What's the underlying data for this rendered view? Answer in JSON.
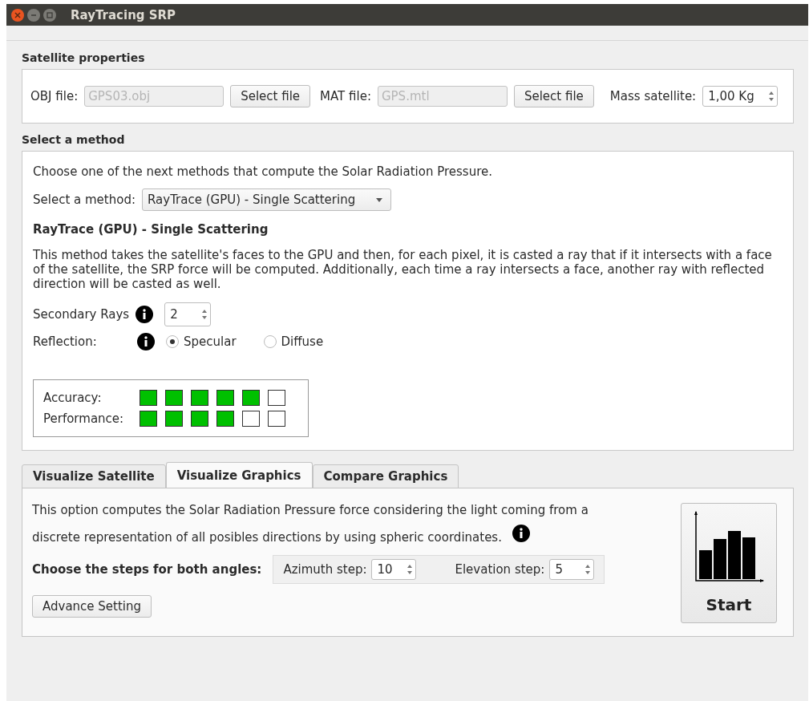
{
  "window": {
    "title": "RayTracing SRP"
  },
  "satellite_properties": {
    "title": "Satellite properties",
    "obj_label": "OBJ file:",
    "obj_value": "GPS03.obj",
    "obj_button": "Select file",
    "mat_label": "MAT file:",
    "mat_value": "GPS.mtl",
    "mat_button": "Select file",
    "mass_label": "Mass satellite:",
    "mass_value": "1,00 Kg"
  },
  "method": {
    "title": "Select a method",
    "intro": "Choose one of the next methods that compute the Solar Radiation Pressure.",
    "select_label": "Select a method:",
    "select_value": "RayTrace (GPU) - Single Scattering",
    "heading": "RayTrace (GPU) - Single Scattering",
    "description": "This method takes the satellite's faces to the GPU and then, for each pixel, it is casted a ray that if it intersects with a face of the satellite, the SRP force will be computed. Additionally, each time a ray intersects a face, another ray with reflected direction will be casted as well.",
    "secondary_label": "Secondary Rays",
    "secondary_value": "2",
    "reflection_label": "Reflection:",
    "reflection_options": [
      {
        "label": "Specular",
        "selected": true
      },
      {
        "label": "Diffuse",
        "selected": false
      }
    ],
    "ratings": [
      {
        "label": "Accuracy:",
        "stars": 5
      },
      {
        "label": "Performance:",
        "stars": 4
      }
    ]
  },
  "tabs": [
    {
      "label": "Visualize Satellite",
      "selected": false
    },
    {
      "label": "Visualize Graphics",
      "selected": true
    },
    {
      "label": "Compare Graphics",
      "selected": false
    }
  ],
  "panel": {
    "description": "This option computes the Solar Radiation Pressure force considering the light coming from a discrete representation of all posibles directions by using spheric coordinates.",
    "steps_label": "Choose the steps for both angles:",
    "azimuth_label": "Azimuth step:",
    "azimuth_value": "10",
    "elevation_label": "Elevation step:",
    "elevation_value": "5",
    "advance_button": "Advance Setting",
    "start_button": "Start"
  }
}
